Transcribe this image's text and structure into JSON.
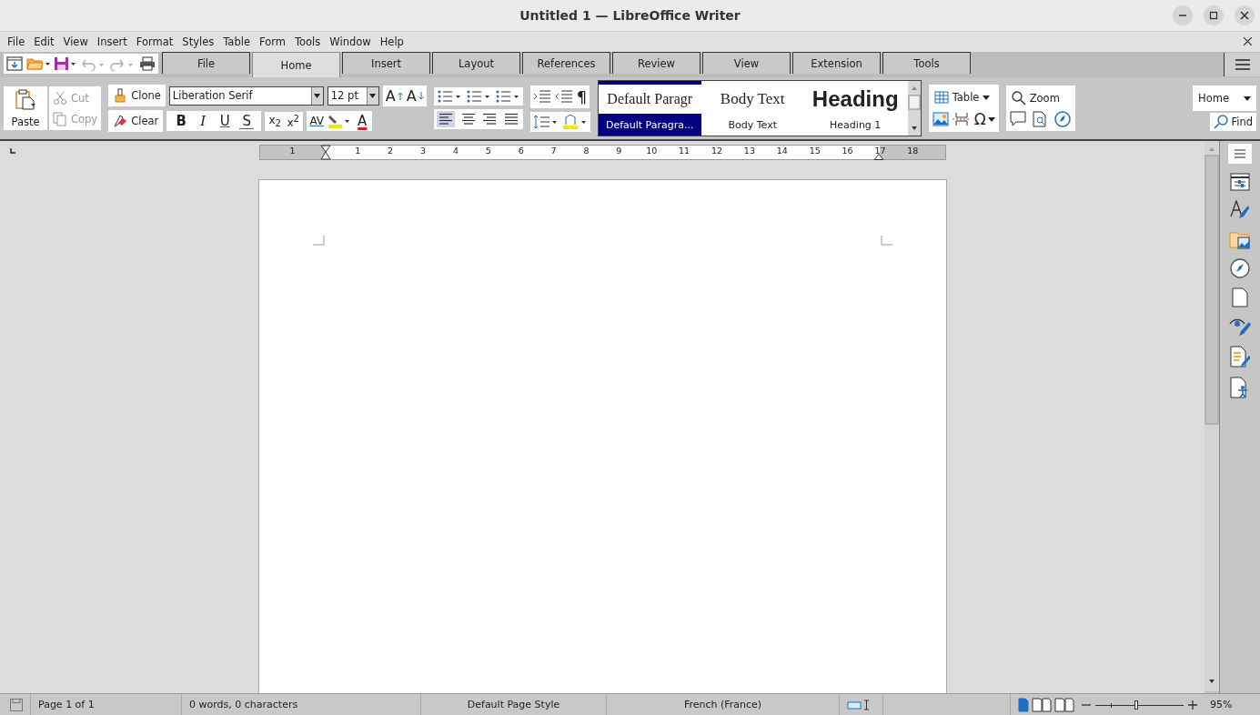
{
  "window": {
    "title": "Untitled 1 — LibreOffice Writer"
  },
  "menu_bar": [
    "File",
    "Edit",
    "View",
    "Insert",
    "Format",
    "Styles",
    "Table",
    "Form",
    "Tools",
    "Window",
    "Help"
  ],
  "tabs": [
    {
      "label": "File",
      "selected": false
    },
    {
      "label": "Home",
      "selected": true
    },
    {
      "label": "Insert",
      "selected": false
    },
    {
      "label": "Layout",
      "selected": false
    },
    {
      "label": "References",
      "selected": false
    },
    {
      "label": "Review",
      "selected": false
    },
    {
      "label": "View",
      "selected": false
    },
    {
      "label": "Extension",
      "selected": false
    },
    {
      "label": "Tools",
      "selected": false
    }
  ],
  "toolbar": {
    "paste": "Paste",
    "cut": {
      "label": "Cut",
      "disabled": true
    },
    "copy": {
      "label": "Copy",
      "disabled": true
    },
    "clone": "Clone",
    "clear": "Clear",
    "font_name": "Liberation Serif",
    "font_size": "12 pt",
    "grow_glyph": "A",
    "shrink_glyph": "A",
    "format_buttons": [
      {
        "label": "B",
        "kind": "bold"
      },
      {
        "label": "I",
        "kind": "italic"
      },
      {
        "label": "U",
        "kind": "underline"
      },
      {
        "label": "S",
        "kind": "strikethrough"
      }
    ],
    "script_buttons": [
      "x$_{2}$",
      "x$^{2}$"
    ],
    "spacing_glyph": "AV",
    "font_color_glyph": "A",
    "pilcrow": "¶",
    "alignment": [
      {
        "kind": "left",
        "selected": true
      },
      {
        "kind": "center",
        "selected": false
      },
      {
        "kind": "right",
        "selected": false
      },
      {
        "kind": "justify",
        "selected": false
      }
    ],
    "styles": [
      {
        "preview": "Default Paragr",
        "name": "Default Paragra...",
        "kind": "default",
        "selected": true
      },
      {
        "preview": "Body Text",
        "name": "Body Text",
        "kind": "body",
        "selected": false
      },
      {
        "preview": "Heading",
        "name": "Heading 1",
        "kind": "heading",
        "selected": false
      }
    ],
    "table": "Table",
    "special_char_glyph": "Ω",
    "zoom": "Zoom",
    "navigate": "Home",
    "find": "Find"
  },
  "ruler": {
    "labels": [
      "1",
      "1",
      "2",
      "3",
      "4",
      "5",
      "6",
      "7",
      "8",
      "9",
      "10",
      "11",
      "12",
      "13",
      "14",
      "15",
      "16",
      "17",
      "18"
    ]
  },
  "status_bar": {
    "page": "Page 1 of 1",
    "words": "0 words, 0 characters",
    "page_style": "Default Page Style",
    "language": "French (France)",
    "view_modes": [
      {
        "selected": true
      },
      {
        "selected": false
      },
      {
        "selected": false
      }
    ],
    "zoom_slider": {
      "level": 0.46
    },
    "zoom": "95%"
  }
}
